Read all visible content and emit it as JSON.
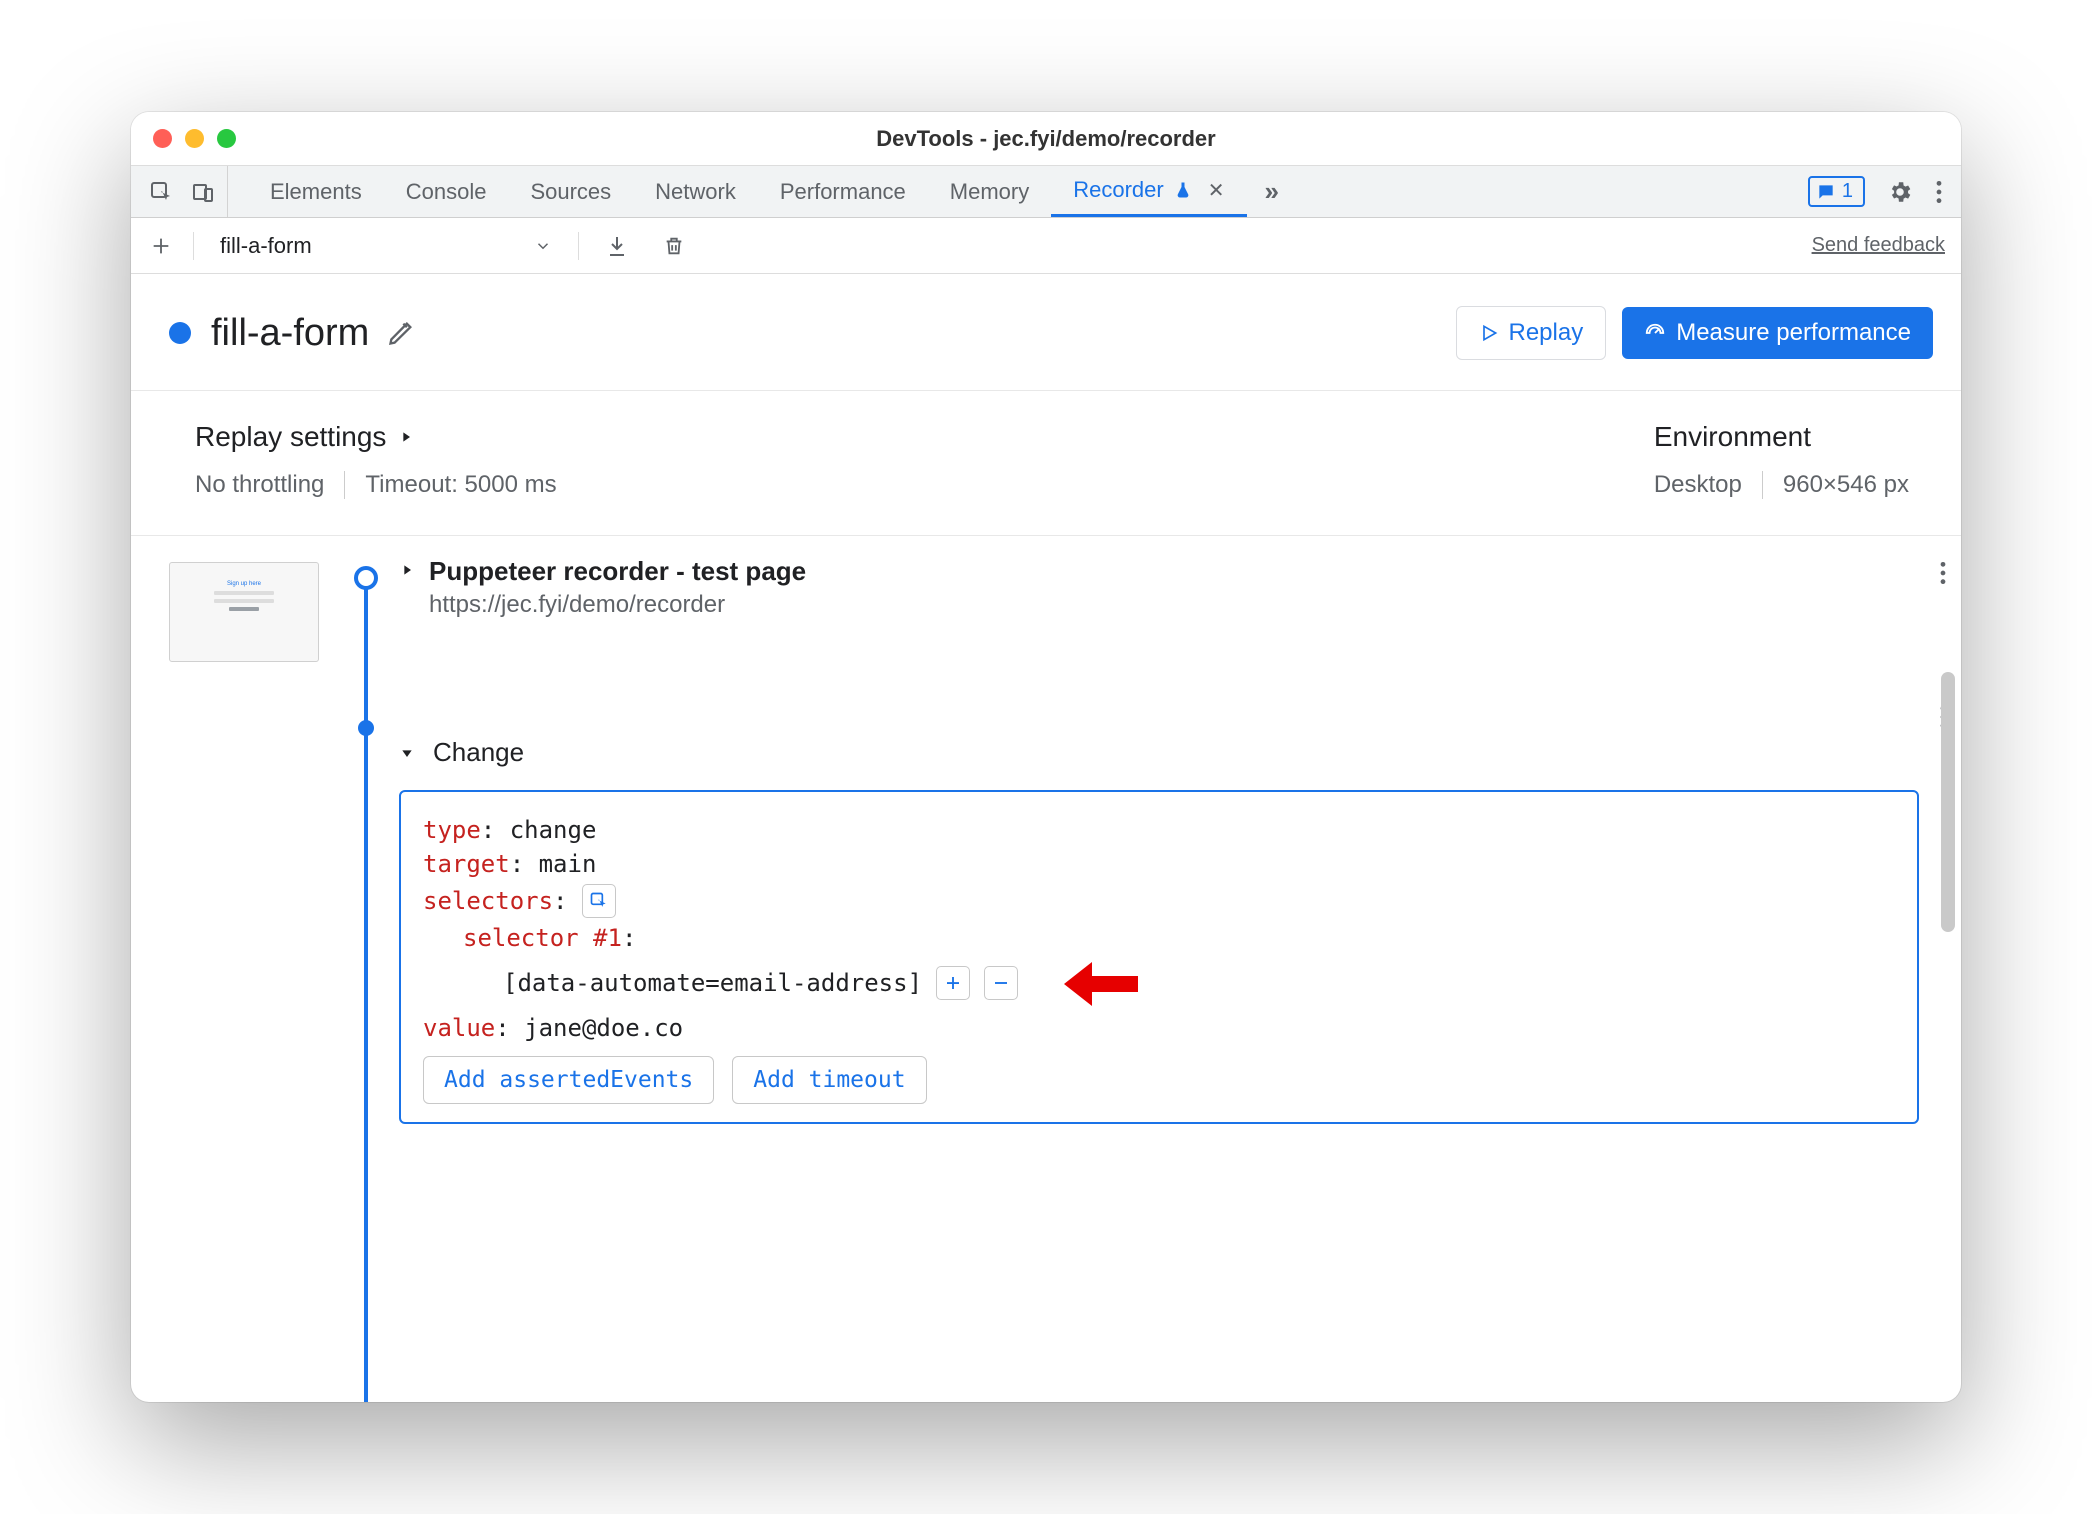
{
  "window": {
    "title": "DevTools - jec.fyi/demo/recorder"
  },
  "tabs": {
    "items": [
      "Elements",
      "Console",
      "Sources",
      "Network",
      "Performance",
      "Memory"
    ],
    "active": "Recorder",
    "issues_count": "1"
  },
  "toolbar": {
    "recording_name": "fill-a-form",
    "feedback": "Send feedback"
  },
  "header": {
    "title": "fill-a-form",
    "replay_btn": "Replay",
    "measure_btn": "Measure performance"
  },
  "settings": {
    "replay_heading": "Replay settings",
    "throttling": "No throttling",
    "timeout": "Timeout: 5000 ms",
    "env_heading": "Environment",
    "device": "Desktop",
    "viewport": "960×546 px"
  },
  "steps": {
    "nav": {
      "title": "Puppeteer recorder - test page",
      "url": "https://jec.fyi/demo/recorder"
    },
    "change": {
      "label": "Change",
      "type_k": "type",
      "type_v": "change",
      "target_k": "target",
      "target_v": "main",
      "selectors_k": "selectors",
      "selector1_k": "selector #1",
      "selector1_v": "[data-automate=email-address]",
      "value_k": "value",
      "value_v": "jane@doe.co",
      "add_asserted": "Add assertedEvents",
      "add_timeout": "Add timeout"
    }
  }
}
